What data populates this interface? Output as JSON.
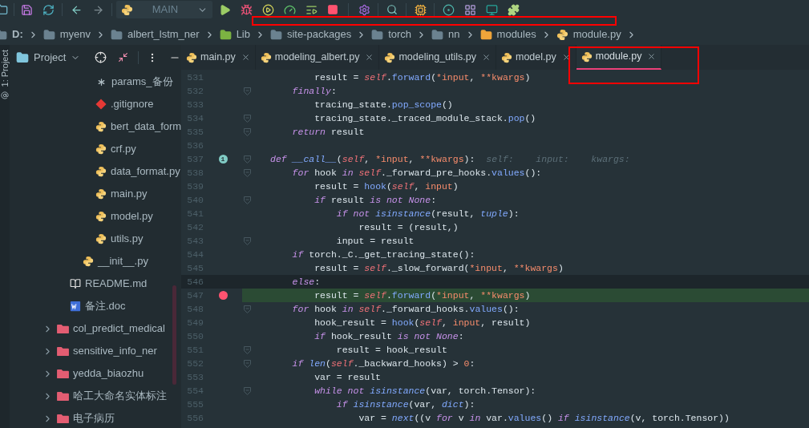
{
  "toolbar": {
    "run_config": {
      "label": "MAIN"
    }
  },
  "breadcrumb": [
    {
      "label": "D:",
      "kind": "folder"
    },
    {
      "label": "myenv",
      "kind": "folder"
    },
    {
      "label": "albert_lstm_ner",
      "kind": "folder"
    },
    {
      "label": "Lib",
      "kind": "library"
    },
    {
      "label": "site-packages",
      "kind": "folder"
    },
    {
      "label": "torch",
      "kind": "folder"
    },
    {
      "label": "nn",
      "kind": "folder"
    },
    {
      "label": "modules",
      "kind": "package"
    },
    {
      "label": "module.py",
      "kind": "python"
    }
  ],
  "side_strip": {
    "label": "1: Project"
  },
  "project_panel": {
    "title": "Project",
    "tree": [
      {
        "children": [
          {
            "children": [
              {
                "children": [
                  {
                    "label": "params_备份",
                    "kind": "config"
                  },
                  {
                    "label": ".gitignore",
                    "kind": "git"
                  },
                  {
                    "label": "bert_data_form",
                    "kind": "python"
                  },
                  {
                    "label": "crf.py",
                    "kind": "python"
                  },
                  {
                    "label": "data_format.py",
                    "kind": "python"
                  },
                  {
                    "label": "main.py",
                    "kind": "python"
                  },
                  {
                    "label": "model.py",
                    "kind": "python"
                  },
                  {
                    "label": "utils.py",
                    "kind": "python"
                  }
                ]
              },
              {
                "label": "__init__.py",
                "kind": "python"
              }
            ]
          },
          {
            "label": "README.md",
            "kind": "markdown"
          },
          {
            "label": "备注.doc",
            "kind": "word"
          }
        ]
      },
      {
        "label": "col_predict_medical",
        "kind": "folder",
        "expanded": false
      },
      {
        "label": "sensitive_info_ner",
        "kind": "folder",
        "expanded": false
      },
      {
        "label": "yedda_biaozhu",
        "kind": "folder",
        "expanded": false
      },
      {
        "label": "哈工大命名实体标注",
        "kind": "folder",
        "expanded": false
      },
      {
        "label": "电子病历",
        "kind": "folder",
        "expanded": false
      }
    ]
  },
  "tabs": [
    {
      "label": "main.py",
      "selected": false
    },
    {
      "label": "modeling_albert.py",
      "selected": false
    },
    {
      "label": "modeling_utils.py",
      "selected": false
    },
    {
      "label": "model.py",
      "selected": false
    },
    {
      "label": "module.py",
      "selected": true
    }
  ],
  "editor": {
    "lines": [
      {
        "number": "531",
        "fold": false,
        "segments": [
          {
            "text": "        result = ",
            "kind": "plain"
          },
          {
            "text": "self",
            "kind": "self"
          },
          {
            "text": ".",
            "kind": "plain"
          },
          {
            "text": "forward",
            "kind": "call"
          },
          {
            "text": "(",
            "kind": "plain"
          },
          {
            "text": "*input",
            "kind": "param"
          },
          {
            "text": ", ",
            "kind": "plain"
          },
          {
            "text": "**kwargs",
            "kind": "param"
          },
          {
            "text": ")",
            "kind": "plain"
          }
        ]
      },
      {
        "number": "532",
        "fold": true,
        "segments": [
          {
            "text": "    finally",
            "kind": "keyword"
          },
          {
            "text": ":",
            "kind": "plain"
          }
        ]
      },
      {
        "number": "533",
        "fold": false,
        "segments": [
          {
            "text": "        tracing_state.",
            "kind": "plain"
          },
          {
            "text": "pop_scope",
            "kind": "call"
          },
          {
            "text": "()",
            "kind": "plain"
          }
        ]
      },
      {
        "number": "534",
        "fold": true,
        "segments": [
          {
            "text": "        tracing_state._traced_module_stack.",
            "kind": "plain"
          },
          {
            "text": "pop",
            "kind": "call"
          },
          {
            "text": "()",
            "kind": "plain"
          }
        ]
      },
      {
        "number": "535",
        "fold": true,
        "segments": [
          {
            "text": "    return",
            "kind": "keyword"
          },
          {
            "text": " result",
            "kind": "plain"
          }
        ]
      },
      {
        "number": "536",
        "fold": false
      },
      {
        "number": "537",
        "fold": true,
        "badge": "1",
        "segments": [
          {
            "text": "def ",
            "kind": "keyword"
          },
          {
            "text": "__call__",
            "kind": "function_name"
          },
          {
            "text": "(",
            "kind": "plain"
          },
          {
            "text": "self",
            "kind": "self"
          },
          {
            "text": ", ",
            "kind": "plain"
          },
          {
            "text": "*input",
            "kind": "param"
          },
          {
            "text": ", ",
            "kind": "plain"
          },
          {
            "text": "**kwargs",
            "kind": "param"
          },
          {
            "text": "):",
            "kind": "plain"
          },
          {
            "text": "  self:    input:    kwargs:",
            "kind": "hint"
          }
        ]
      },
      {
        "number": "538",
        "fold": true,
        "segments": [
          {
            "text": "    for",
            "kind": "keyword"
          },
          {
            "text": " hook ",
            "kind": "plain"
          },
          {
            "text": "in ",
            "kind": "keyword"
          },
          {
            "text": "self",
            "kind": "self"
          },
          {
            "text": "._forward_pre_hooks.",
            "kind": "plain"
          },
          {
            "text": "values",
            "kind": "call"
          },
          {
            "text": "():",
            "kind": "plain"
          }
        ]
      },
      {
        "number": "539",
        "fold": false,
        "segments": [
          {
            "text": "        result = ",
            "kind": "plain"
          },
          {
            "text": "hook",
            "kind": "call"
          },
          {
            "text": "(",
            "kind": "plain"
          },
          {
            "text": "self",
            "kind": "self"
          },
          {
            "text": ", ",
            "kind": "plain"
          },
          {
            "text": "input",
            "kind": "param"
          },
          {
            "text": ")",
            "kind": "plain"
          }
        ]
      },
      {
        "number": "540",
        "fold": true,
        "segments": [
          {
            "text": "        if",
            "kind": "keyword"
          },
          {
            "text": " result ",
            "kind": "plain"
          },
          {
            "text": "is not None",
            "kind": "keyword"
          },
          {
            "text": ":",
            "kind": "plain"
          }
        ]
      },
      {
        "number": "541",
        "fold": false,
        "segments": [
          {
            "text": "            if not ",
            "kind": "keyword"
          },
          {
            "text": "isinstance",
            "kind": "builtin"
          },
          {
            "text": "(result, ",
            "kind": "plain"
          },
          {
            "text": "tuple",
            "kind": "builtin"
          },
          {
            "text": "):",
            "kind": "plain"
          }
        ]
      },
      {
        "number": "542",
        "fold": false,
        "segments": [
          {
            "text": "                result = (result,)",
            "kind": "plain"
          }
        ]
      },
      {
        "number": "543",
        "fold": true,
        "segments": [
          {
            "text": "            input = result",
            "kind": "plain"
          }
        ]
      },
      {
        "number": "544",
        "fold": false,
        "segments": [
          {
            "text": "    if",
            "kind": "keyword"
          },
          {
            "text": " torch._C._get_tracing_state():",
            "kind": "plain"
          }
        ]
      },
      {
        "number": "545",
        "fold": false,
        "segments": [
          {
            "text": "        result = ",
            "kind": "plain"
          },
          {
            "text": "self",
            "kind": "self"
          },
          {
            "text": "._slow_forward(",
            "kind": "plain"
          },
          {
            "text": "*input",
            "kind": "param"
          },
          {
            "text": ", ",
            "kind": "plain"
          },
          {
            "text": "**kwargs",
            "kind": "param"
          },
          {
            "text": ")",
            "kind": "plain"
          }
        ]
      },
      {
        "number": "546",
        "fold": false,
        "current": true,
        "segments": [
          {
            "text": "    else",
            "kind": "keyword"
          },
          {
            "text": ":",
            "kind": "plain"
          }
        ]
      },
      {
        "number": "547",
        "fold": false,
        "breakpoint": true,
        "segments": [
          {
            "text": "        result = ",
            "kind": "plain"
          },
          {
            "text": "self",
            "kind": "self"
          },
          {
            "text": ".",
            "kind": "plain"
          },
          {
            "text": "forward",
            "kind": "call"
          },
          {
            "text": "(",
            "kind": "plain"
          },
          {
            "text": "*input",
            "kind": "param"
          },
          {
            "text": ", ",
            "kind": "plain"
          },
          {
            "text": "**kwargs",
            "kind": "param"
          },
          {
            "text": ")",
            "kind": "plain"
          }
        ]
      },
      {
        "number": "548",
        "fold": true,
        "segments": [
          {
            "text": "    for",
            "kind": "keyword"
          },
          {
            "text": " hook ",
            "kind": "plain"
          },
          {
            "text": "in ",
            "kind": "keyword"
          },
          {
            "text": "self",
            "kind": "self"
          },
          {
            "text": "._forward_hooks.",
            "kind": "plain"
          },
          {
            "text": "values",
            "kind": "call"
          },
          {
            "text": "():",
            "kind": "plain"
          }
        ]
      },
      {
        "number": "549",
        "fold": false,
        "segments": [
          {
            "text": "        hook_result = ",
            "kind": "plain"
          },
          {
            "text": "hook",
            "kind": "call"
          },
          {
            "text": "(",
            "kind": "plain"
          },
          {
            "text": "self",
            "kind": "self"
          },
          {
            "text": ", ",
            "kind": "plain"
          },
          {
            "text": "input",
            "kind": "param"
          },
          {
            "text": ", result)",
            "kind": "plain"
          }
        ]
      },
      {
        "number": "550",
        "fold": false,
        "segments": [
          {
            "text": "        if",
            "kind": "keyword"
          },
          {
            "text": " hook_result ",
            "kind": "plain"
          },
          {
            "text": "is not None",
            "kind": "keyword"
          },
          {
            "text": ":",
            "kind": "plain"
          }
        ]
      },
      {
        "number": "551",
        "fold": true,
        "segments": [
          {
            "text": "            result = hook_result",
            "kind": "plain"
          }
        ]
      },
      {
        "number": "552",
        "fold": true,
        "segments": [
          {
            "text": "    if ",
            "kind": "keyword"
          },
          {
            "text": "len",
            "kind": "builtin"
          },
          {
            "text": "(",
            "kind": "plain"
          },
          {
            "text": "self",
            "kind": "self"
          },
          {
            "text": "._backward_hooks) > ",
            "kind": "plain"
          },
          {
            "text": "0",
            "kind": "number"
          },
          {
            "text": ":",
            "kind": "plain"
          }
        ]
      },
      {
        "number": "553",
        "fold": false,
        "segments": [
          {
            "text": "        var = result",
            "kind": "plain"
          }
        ]
      },
      {
        "number": "554",
        "fold": true,
        "segments": [
          {
            "text": "        while not ",
            "kind": "keyword"
          },
          {
            "text": "isinstance",
            "kind": "builtin"
          },
          {
            "text": "(var, torch.Tensor):",
            "kind": "plain"
          }
        ]
      },
      {
        "number": "555",
        "fold": false,
        "segments": [
          {
            "text": "            if ",
            "kind": "keyword"
          },
          {
            "text": "isinstance",
            "kind": "builtin"
          },
          {
            "text": "(var, ",
            "kind": "plain"
          },
          {
            "text": "dict",
            "kind": "builtin"
          },
          {
            "text": "):",
            "kind": "plain"
          }
        ]
      },
      {
        "number": "556",
        "fold": false,
        "segments": [
          {
            "text": "                var = ",
            "kind": "plain"
          },
          {
            "text": "next",
            "kind": "builtin"
          },
          {
            "text": "((v ",
            "kind": "plain"
          },
          {
            "text": "for",
            "kind": "keyword"
          },
          {
            "text": " v ",
            "kind": "plain"
          },
          {
            "text": "in",
            "kind": "keyword"
          },
          {
            "text": " var.",
            "kind": "plain"
          },
          {
            "text": "values",
            "kind": "call"
          },
          {
            "text": "() ",
            "kind": "plain"
          },
          {
            "text": "if ",
            "kind": "keyword"
          },
          {
            "text": "isinstance",
            "kind": "builtin"
          },
          {
            "text": "(v, torch.Tensor))",
            "kind": "plain"
          }
        ]
      }
    ]
  }
}
